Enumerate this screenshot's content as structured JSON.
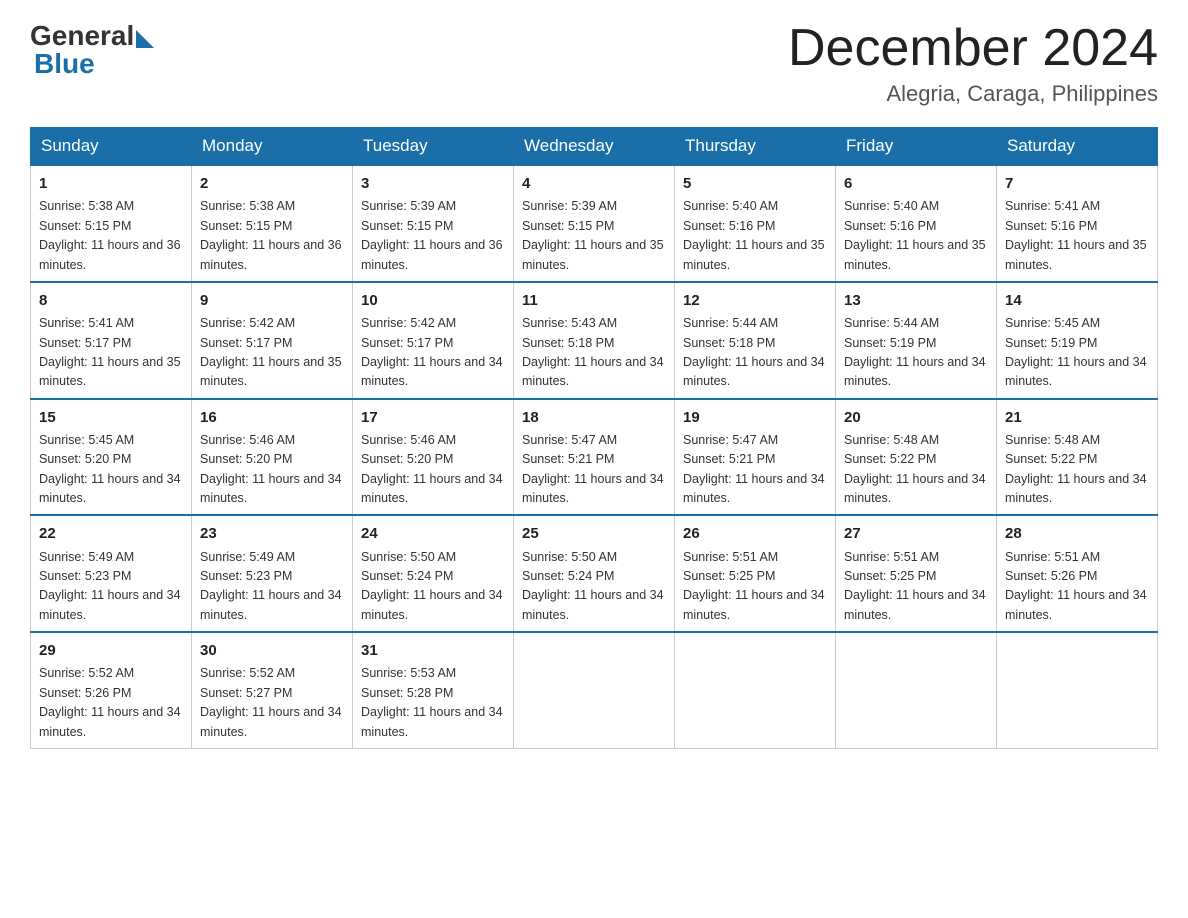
{
  "logo": {
    "general": "General",
    "blue": "Blue"
  },
  "title": "December 2024",
  "location": "Alegria, Caraga, Philippines",
  "headers": [
    "Sunday",
    "Monday",
    "Tuesday",
    "Wednesday",
    "Thursday",
    "Friday",
    "Saturday"
  ],
  "weeks": [
    [
      {
        "day": "1",
        "sunrise": "5:38 AM",
        "sunset": "5:15 PM",
        "daylight": "11 hours and 36 minutes."
      },
      {
        "day": "2",
        "sunrise": "5:38 AM",
        "sunset": "5:15 PM",
        "daylight": "11 hours and 36 minutes."
      },
      {
        "day": "3",
        "sunrise": "5:39 AM",
        "sunset": "5:15 PM",
        "daylight": "11 hours and 36 minutes."
      },
      {
        "day": "4",
        "sunrise": "5:39 AM",
        "sunset": "5:15 PM",
        "daylight": "11 hours and 35 minutes."
      },
      {
        "day": "5",
        "sunrise": "5:40 AM",
        "sunset": "5:16 PM",
        "daylight": "11 hours and 35 minutes."
      },
      {
        "day": "6",
        "sunrise": "5:40 AM",
        "sunset": "5:16 PM",
        "daylight": "11 hours and 35 minutes."
      },
      {
        "day": "7",
        "sunrise": "5:41 AM",
        "sunset": "5:16 PM",
        "daylight": "11 hours and 35 minutes."
      }
    ],
    [
      {
        "day": "8",
        "sunrise": "5:41 AM",
        "sunset": "5:17 PM",
        "daylight": "11 hours and 35 minutes."
      },
      {
        "day": "9",
        "sunrise": "5:42 AM",
        "sunset": "5:17 PM",
        "daylight": "11 hours and 35 minutes."
      },
      {
        "day": "10",
        "sunrise": "5:42 AM",
        "sunset": "5:17 PM",
        "daylight": "11 hours and 34 minutes."
      },
      {
        "day": "11",
        "sunrise": "5:43 AM",
        "sunset": "5:18 PM",
        "daylight": "11 hours and 34 minutes."
      },
      {
        "day": "12",
        "sunrise": "5:44 AM",
        "sunset": "5:18 PM",
        "daylight": "11 hours and 34 minutes."
      },
      {
        "day": "13",
        "sunrise": "5:44 AM",
        "sunset": "5:19 PM",
        "daylight": "11 hours and 34 minutes."
      },
      {
        "day": "14",
        "sunrise": "5:45 AM",
        "sunset": "5:19 PM",
        "daylight": "11 hours and 34 minutes."
      }
    ],
    [
      {
        "day": "15",
        "sunrise": "5:45 AM",
        "sunset": "5:20 PM",
        "daylight": "11 hours and 34 minutes."
      },
      {
        "day": "16",
        "sunrise": "5:46 AM",
        "sunset": "5:20 PM",
        "daylight": "11 hours and 34 minutes."
      },
      {
        "day": "17",
        "sunrise": "5:46 AM",
        "sunset": "5:20 PM",
        "daylight": "11 hours and 34 minutes."
      },
      {
        "day": "18",
        "sunrise": "5:47 AM",
        "sunset": "5:21 PM",
        "daylight": "11 hours and 34 minutes."
      },
      {
        "day": "19",
        "sunrise": "5:47 AM",
        "sunset": "5:21 PM",
        "daylight": "11 hours and 34 minutes."
      },
      {
        "day": "20",
        "sunrise": "5:48 AM",
        "sunset": "5:22 PM",
        "daylight": "11 hours and 34 minutes."
      },
      {
        "day": "21",
        "sunrise": "5:48 AM",
        "sunset": "5:22 PM",
        "daylight": "11 hours and 34 minutes."
      }
    ],
    [
      {
        "day": "22",
        "sunrise": "5:49 AM",
        "sunset": "5:23 PM",
        "daylight": "11 hours and 34 minutes."
      },
      {
        "day": "23",
        "sunrise": "5:49 AM",
        "sunset": "5:23 PM",
        "daylight": "11 hours and 34 minutes."
      },
      {
        "day": "24",
        "sunrise": "5:50 AM",
        "sunset": "5:24 PM",
        "daylight": "11 hours and 34 minutes."
      },
      {
        "day": "25",
        "sunrise": "5:50 AM",
        "sunset": "5:24 PM",
        "daylight": "11 hours and 34 minutes."
      },
      {
        "day": "26",
        "sunrise": "5:51 AM",
        "sunset": "5:25 PM",
        "daylight": "11 hours and 34 minutes."
      },
      {
        "day": "27",
        "sunrise": "5:51 AM",
        "sunset": "5:25 PM",
        "daylight": "11 hours and 34 minutes."
      },
      {
        "day": "28",
        "sunrise": "5:51 AM",
        "sunset": "5:26 PM",
        "daylight": "11 hours and 34 minutes."
      }
    ],
    [
      {
        "day": "29",
        "sunrise": "5:52 AM",
        "sunset": "5:26 PM",
        "daylight": "11 hours and 34 minutes."
      },
      {
        "day": "30",
        "sunrise": "5:52 AM",
        "sunset": "5:27 PM",
        "daylight": "11 hours and 34 minutes."
      },
      {
        "day": "31",
        "sunrise": "5:53 AM",
        "sunset": "5:28 PM",
        "daylight": "11 hours and 34 minutes."
      },
      null,
      null,
      null,
      null
    ]
  ]
}
